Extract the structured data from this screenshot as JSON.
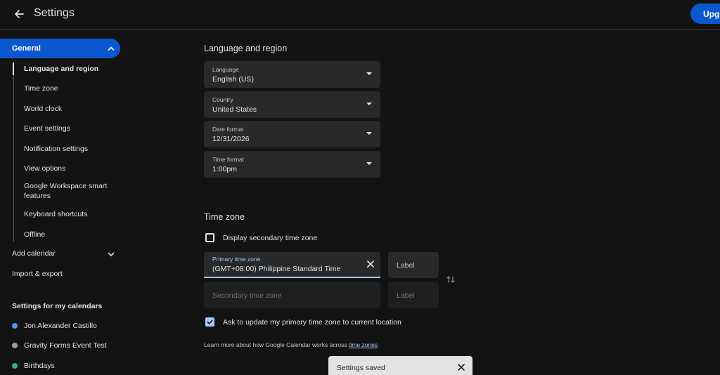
{
  "header": {
    "title": "Settings",
    "upgrade_label": "Upgrade"
  },
  "sidebar": {
    "general_label": "General",
    "sub_items": [
      "Language and region",
      "Time zone",
      "World clock",
      "Event settings",
      "Notification settings",
      "View options",
      "Google Workspace smart features",
      "Keyboard shortcuts",
      "Offline"
    ],
    "add_calendar": "Add calendar",
    "import_export": "Import & export",
    "my_calendars_heading": "Settings for my calendars",
    "calendars": [
      {
        "name": "Jon Alexander Castillo",
        "color": "#4e9ae8"
      },
      {
        "name": "Gravity Forms Event Test",
        "color": "#a79b8e"
      },
      {
        "name": "Birthdays",
        "color": "#33b679"
      }
    ]
  },
  "language_region": {
    "heading": "Language and region",
    "fields": [
      {
        "label": "Language",
        "value": "English (US)"
      },
      {
        "label": "Country",
        "value": "United States"
      },
      {
        "label": "Date format",
        "value": "12/31/2026"
      },
      {
        "label": "Time format",
        "value": "1:00pm"
      }
    ]
  },
  "time_zone": {
    "heading": "Time zone",
    "secondary_checkbox": {
      "label": "Display secondary time zone",
      "checked": false
    },
    "primary": {
      "label": "Primary time zone",
      "value": "(GMT+08:00) Philippine Standard Time"
    },
    "primary_label_placeholder": "Label",
    "secondary_placeholder": "Secondary time zone",
    "secondary_label_placeholder": "Label",
    "ask_update": {
      "label": "Ask to update my primary time zone to current location",
      "checked": true
    },
    "learn_more_text": "Learn more about how Google Calendar works across",
    "learn_more_link": "time zones"
  },
  "toast": {
    "message": "Settings saved"
  },
  "colors": {
    "accent": "#0b57d0",
    "accent_light": "#a8c7fa",
    "background": "#131314",
    "field_bg": "#28292a"
  },
  "icons": {
    "back": "arrow-back-icon",
    "chevron_up": "chevron-up-icon",
    "chevron_down": "chevron-down-icon",
    "dropdown": "dropdown-arrow-icon",
    "clear": "close-icon",
    "swap": "swap-vertical-icon",
    "check": "check-icon"
  }
}
